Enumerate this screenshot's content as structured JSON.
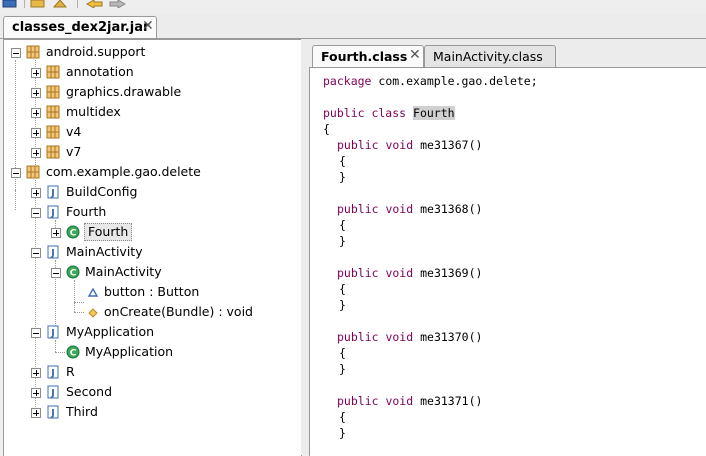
{
  "file_tab": {
    "label": "classes_dex2jar.jar",
    "close": "✕"
  },
  "tree": {
    "pkg1": "android.support",
    "pkg1_children": [
      "annotation",
      "graphics.drawable",
      "multidex",
      "v4",
      "v7"
    ],
    "pkg2": "com.example.gao.delete",
    "buildconfig": "BuildConfig",
    "fourth_file": "Fourth",
    "fourth_class": "Fourth",
    "mainactivity_file": "MainActivity",
    "mainactivity_class": "MainActivity",
    "button_field": "button : Button",
    "oncreate_method": "onCreate(Bundle) : void",
    "myapplication_file": "MyApplication",
    "myapplication_class": "MyApplication",
    "r_file": "R",
    "second_file": "Second",
    "third_file": "Third"
  },
  "editor_tabs": {
    "active": "Fourth.class",
    "inactive": "MainActivity.class",
    "close": "✕"
  },
  "code": {
    "package_kw": "package",
    "package_name": " com.example.gao.delete;",
    "class_kw": "public class",
    "class_name": "Fourth",
    "open_brace": "{",
    "method_kw": "public void",
    "methods": [
      "me31367()",
      "me31368()",
      "me31369()",
      "me31370()",
      "me31371()"
    ],
    "method_open": "{",
    "method_close": "}"
  },
  "colors": {
    "keyword": "#7f0055",
    "package_icon": "#c8882a",
    "class_icon": "#2e9c4a",
    "java_icon": "#3f6fb3"
  }
}
